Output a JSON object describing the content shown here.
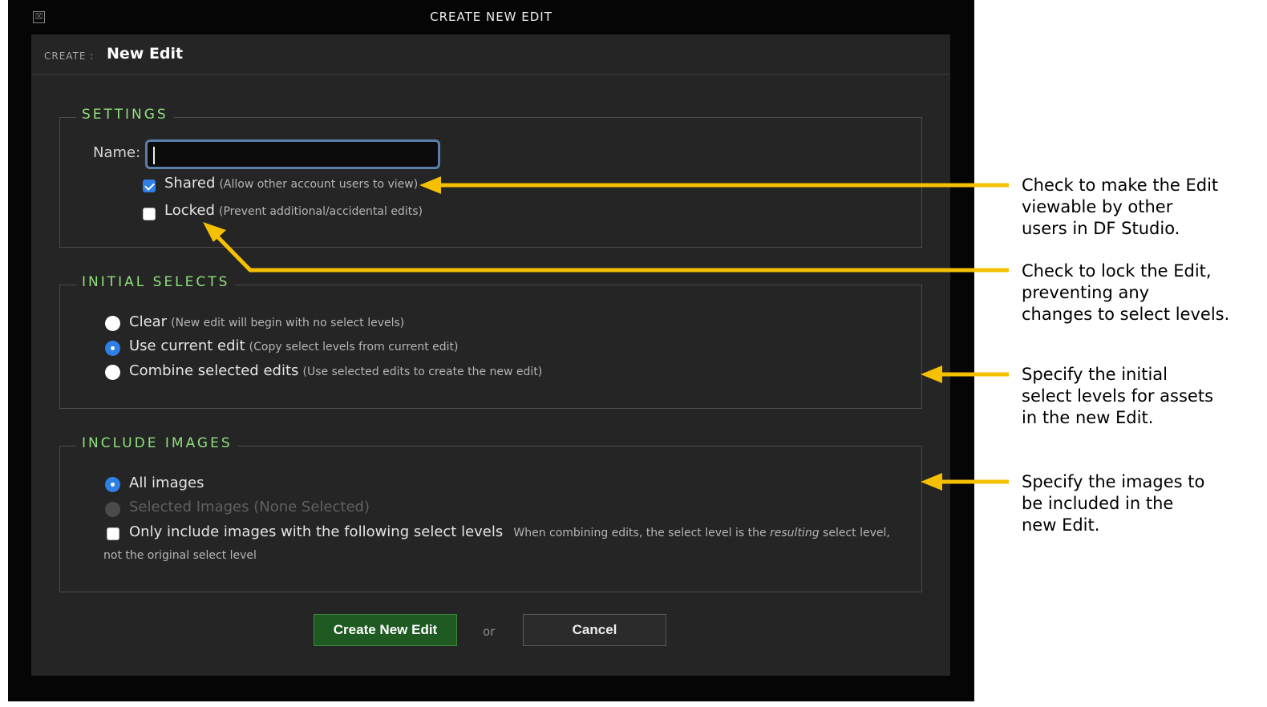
{
  "dialog": {
    "title": "CREATE NEW EDIT",
    "close_glyph": "☒",
    "create_label": "CREATE :",
    "create_value": "New Edit"
  },
  "settings": {
    "legend": "SETTINGS",
    "name_label": "Name:",
    "name_value": "",
    "shared": {
      "label": "Shared",
      "note": "(Allow other account users to view)",
      "checked": true
    },
    "locked": {
      "label": "Locked",
      "note": "(Prevent additional/accidental edits)",
      "checked": false
    }
  },
  "initial_selects": {
    "legend": "INITIAL SELECTS",
    "options": [
      {
        "label": "Clear",
        "note": "(New edit will begin with no select levels)",
        "checked": false
      },
      {
        "label": "Use current edit",
        "note": "(Copy select levels from current edit)",
        "checked": true
      },
      {
        "label": "Combine selected edits",
        "note": "(Use selected edits to create the new edit)",
        "checked": false
      }
    ]
  },
  "include_images": {
    "legend": "INCLUDE IMAGES",
    "all_images": {
      "label": "All images",
      "checked": true
    },
    "selected_images": {
      "label": "Selected Images (None Selected)",
      "disabled": true
    },
    "only_include": {
      "label": "Only include images with the following select levels",
      "note_part1": "When combining edits, the select level is the ",
      "note_emph": "resulting",
      "note_part2": " select level,",
      "note_line2": "not the original select level",
      "checked": false
    }
  },
  "buttons": {
    "create": "Create New Edit",
    "or": "or",
    "cancel": "Cancel"
  },
  "callouts": {
    "shared": [
      "Check to make the Edit",
      "viewable by other",
      "users in DF Studio."
    ],
    "locked": [
      "Check to lock the Edit,",
      "preventing any",
      "changes to select levels."
    ],
    "selects": [
      "Specify the initial",
      "select levels for assets",
      "in the new Edit."
    ],
    "images": [
      "Specify the images to",
      "be included in the",
      "new Edit."
    ]
  },
  "colors": {
    "accent_green": "#8fe07c",
    "arrow": "#f5c000",
    "checkbox_blue": "#2f7fe6",
    "create_button": "#1e5a22"
  }
}
